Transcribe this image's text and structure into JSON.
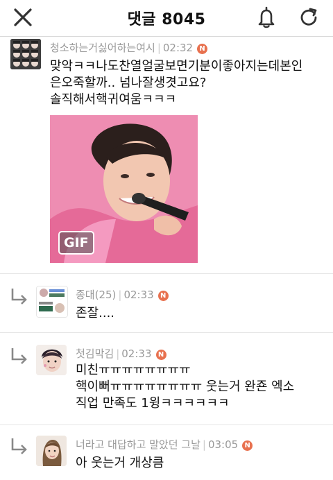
{
  "header": {
    "title": "댓글 8045",
    "close_icon": "close-icon",
    "bell_icon": "bell-icon",
    "refresh_icon": "refresh-icon"
  },
  "comments": [
    {
      "author": "청소하는거싫어하는여시",
      "time": "02:32",
      "badge": "N",
      "lines": [
        "맞악ㅋㅋ나도찬열얼굴보면기분이좋아지는데본인",
        "은오죽할까.. 넘나잘생겻고요?",
        "솔직해서핵귀여움ㅋㅋㅋ"
      ],
      "media_badge": "GIF"
    },
    {
      "author": "종대(25)",
      "time": "02:33",
      "badge": "N",
      "lines": [
        "존잘...."
      ]
    },
    {
      "author": "첫김막김",
      "time": "02:33",
      "badge": "N",
      "lines": [
        "미친ㅠㅠㅠㅠㅠㅠㅠㅠ",
        "핵이뻐ㅠㅠㅠㅠㅠㅠㅠㅠ 웃는거 완죤 엑소",
        "직업 만족도 1윙ㅋㅋㅋㅋㅋㅋ"
      ]
    },
    {
      "author": "너라고 대답하고 말았던 그날",
      "time": "03:05",
      "badge": "N",
      "lines": [
        "아 웃는거 개상큼"
      ]
    }
  ],
  "colors": {
    "badge": "#e8714f",
    "meta": "#999999",
    "gif_bg": "#ee86ad"
  }
}
